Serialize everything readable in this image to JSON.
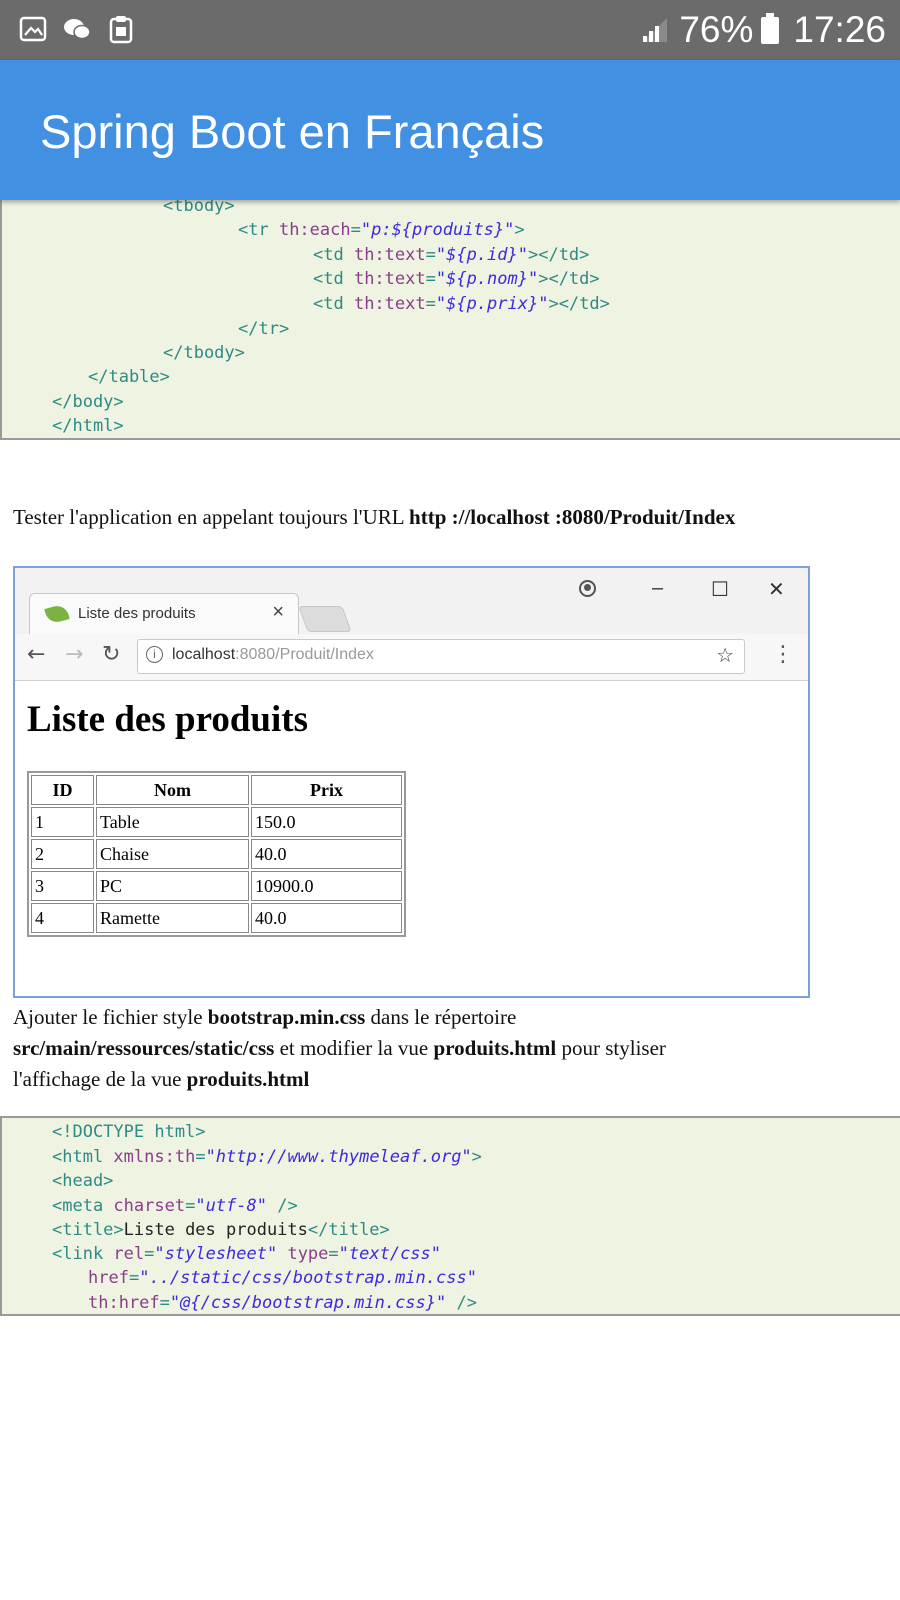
{
  "status_bar": {
    "battery": "76%",
    "time": "17:26",
    "icons": [
      "gallery-icon",
      "wechat-icon",
      "clipboard-icon",
      "signal-icon",
      "battery-icon"
    ]
  },
  "app_bar": {
    "title": "Spring Boot en Français"
  },
  "code_top": {
    "lines": [
      {
        "t1": "<tbody>"
      },
      {
        "t1": "<tr ",
        "a1": "th:each",
        "e1": "=",
        "v1": "\"p:${produits}\"",
        "t2": ">"
      },
      {
        "t1": "<td ",
        "a1": "th:text",
        "e1": "=",
        "v1": "\"${p.id}\"",
        "t2": "></td>"
      },
      {
        "t1": "<td ",
        "a1": "th:text",
        "e1": "=",
        "v1": "\"${p.nom}\"",
        "t2": "></td>"
      },
      {
        "t1": "<td ",
        "a1": "th:text",
        "e1": "=",
        "v1": "\"${p.prix}\"",
        "t2": "></td>"
      },
      {
        "t1": "</tr>"
      },
      {
        "t1": "</tbody>"
      },
      {
        "t1": "</table>"
      },
      {
        "t1": "</body>"
      },
      {
        "t1": "</html>"
      }
    ]
  },
  "para1": {
    "text": "Tester l'application en appelant toujours l'URL ",
    "url": "http ://localhost :8080/Produit/Index"
  },
  "browser": {
    "tab_title": "Liste des produits",
    "tab_close": "×",
    "url_host": "localhost",
    "url_rest": ":8080/Produit/Index",
    "info_glyph": "i",
    "back": "←",
    "forward": "→",
    "reload": "↻",
    "star": "☆",
    "menu": "⋮",
    "minimize": "–",
    "maximize": "☐",
    "close": "✕",
    "page_heading": "Liste des produits",
    "table": {
      "headers": [
        "ID",
        "Nom",
        "Prix"
      ],
      "rows": [
        [
          "1",
          "Table",
          "150.0"
        ],
        [
          "2",
          "Chaise",
          "40.0"
        ],
        [
          "3",
          "PC",
          "10900.0"
        ],
        [
          "4",
          "Ramette",
          "40.0"
        ]
      ]
    }
  },
  "para2": {
    "l1a": "Ajouter le fichier style ",
    "l1b": "bootstrap.min.css",
    "l1c": " dans le répertoire",
    "l2a": "src/main/ressources/static/css",
    "l2b": " et modifier la vue ",
    "l2c": "produits.html",
    "l2d": " pour styliser",
    "l3a": "l'affichage de la vue ",
    "l3b": "produits.html"
  },
  "code_bottom": {
    "l1": "<!DOCTYPE html>",
    "l2": {
      "t1": "<html ",
      "a1": "xmlns:th",
      "e1": "=",
      "v1": "\"http://www.thymeleaf.org\"",
      "t2": ">"
    },
    "l3": "<head>",
    "l4": {
      "t1": "<meta ",
      "a1": "charset",
      "e1": "=",
      "v1": "\"utf-8\"",
      "t2": " />"
    },
    "l5": {
      "t1": "<title>",
      "x1": "Liste des produits",
      "t2": "</title>"
    },
    "l6": {
      "t1": "<link ",
      "a1": "rel",
      "e1": "=",
      "v1": "\"stylesheet\"",
      "a2": " type",
      "e2": "=",
      "v2": "\"text/css\""
    },
    "l7": {
      "a1": "href",
      "e1": "=",
      "v1": "\"../static/css/bootstrap.min.css\""
    },
    "l8": {
      "a1": "th:href",
      "e1": "=",
      "v1": "\"@{/css/bootstrap.min.css}\"",
      "t2": " />"
    }
  }
}
